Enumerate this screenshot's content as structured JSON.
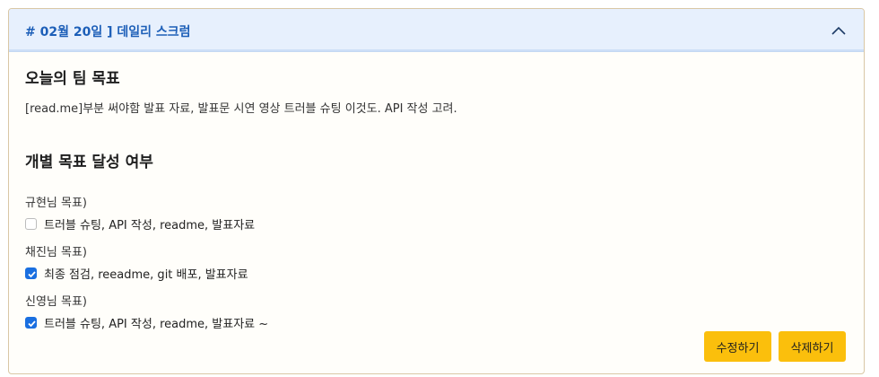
{
  "header": {
    "title": "# 02월 20일 ] 데일리 스크럼",
    "toggle_icon": "chevron-up-icon"
  },
  "team_goal": {
    "heading": "오늘의 팀 목표",
    "text": "[read.me]부분 써야함 발표 자료, 발표문 시연 영상 트러블 슈팅 이것도. API 작성 고려."
  },
  "individual": {
    "heading": "개별 목표 달성 여부",
    "members": [
      {
        "label": "규현님 목표)",
        "task": "트러블 슈팅, API 작성, readme, 발표자료",
        "checked": false
      },
      {
        "label": "채진님 목표)",
        "task": "최종 점검, reeadme, git 배포, 발표자료",
        "checked": true
      },
      {
        "label": "신영님 목표)",
        "task": "트러블 슈팅, API 작성, readme, 발표자료 ~",
        "checked": true
      }
    ]
  },
  "actions": {
    "edit_label": "수정하기",
    "delete_label": "삭제하기"
  },
  "colors": {
    "accent": "#1a6fe0",
    "header_bg": "#e7f0fd",
    "button": "#fbbf0c"
  }
}
